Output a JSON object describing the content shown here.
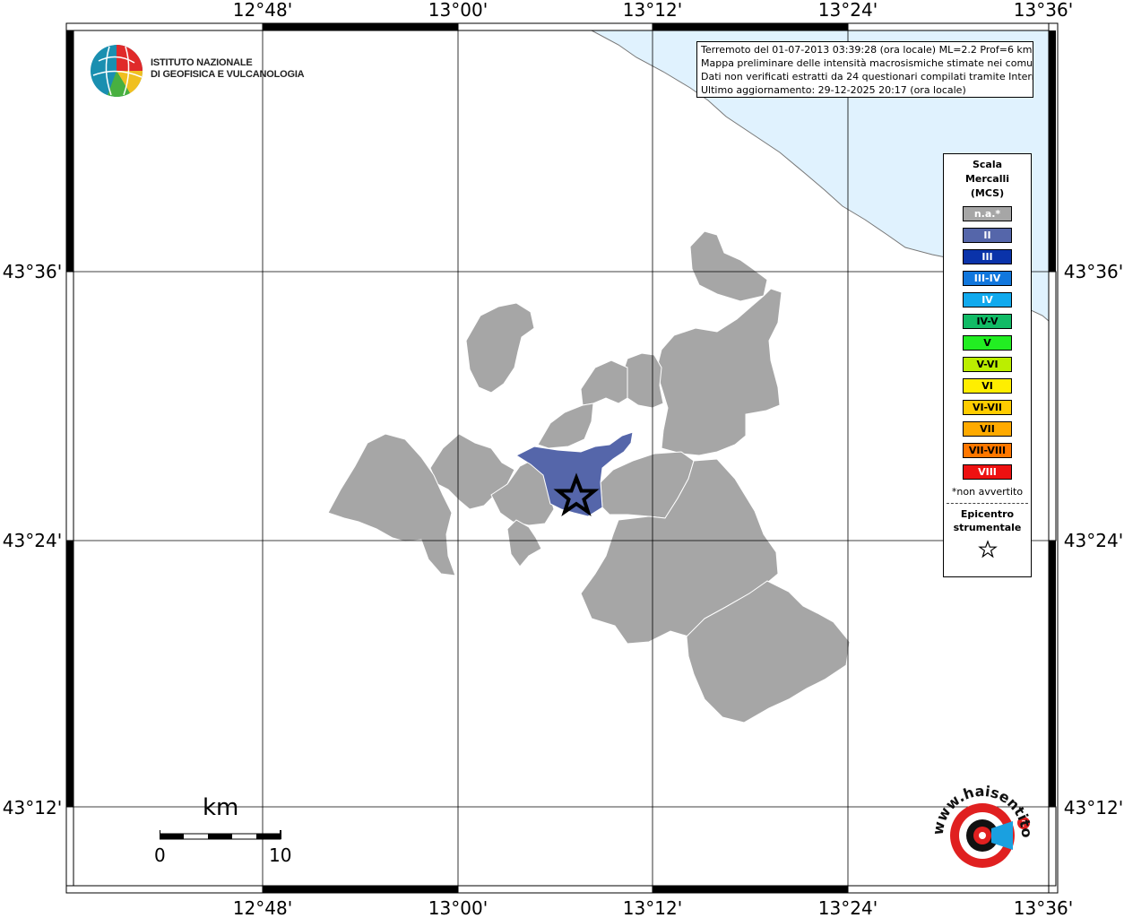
{
  "axes": {
    "longitude_labels": [
      "12°48'",
      "13°00'",
      "13°12'",
      "13°24'",
      "13°36'"
    ],
    "latitude_labels": [
      "43°36'",
      "43°24'",
      "43°12'"
    ]
  },
  "institute": {
    "line1": "ISTITUTO NAZIONALE",
    "line2": "DI GEOFISICA E VULCANOLOGIA"
  },
  "info": {
    "line1": "Terremoto del 01-07-2013 03:39:28 (ora locale) ML=2.2 Prof=6 km",
    "line2": "Mappa preliminare delle intensità macrosismiche stimate nei comuni",
    "line3": "Dati non verificati estratti da 24 questionari compilati tramite Internet.",
    "line4": "Ultimo aggiornamento: 29-12-2025 20:17 (ora locale)"
  },
  "legend": {
    "title_line1": "Scala",
    "title_line2": "Mercalli",
    "title_line3": "(MCS)",
    "items": [
      {
        "label": "n.a.*",
        "color": "#a6a6a6",
        "text_color": "#ffffff"
      },
      {
        "label": "II",
        "color": "#5566aa",
        "text_color": "#ffffff"
      },
      {
        "label": "III",
        "color": "#0a33aa",
        "text_color": "#ffffff"
      },
      {
        "label": "III-IV",
        "color": "#1177dd",
        "text_color": "#ffffff"
      },
      {
        "label": "IV",
        "color": "#11aaee",
        "text_color": "#ffffff"
      },
      {
        "label": "IV-V",
        "color": "#11bb66",
        "text_color": "#000000"
      },
      {
        "label": "V",
        "color": "#22ee22",
        "text_color": "#000000"
      },
      {
        "label": "V-VI",
        "color": "#bbee00",
        "text_color": "#000000"
      },
      {
        "label": "VI",
        "color": "#ffee00",
        "text_color": "#000000"
      },
      {
        "label": "VI-VII",
        "color": "#ffcc00",
        "text_color": "#000000"
      },
      {
        "label": "VII",
        "color": "#ffaa00",
        "text_color": "#000000"
      },
      {
        "label": "VII-VIII",
        "color": "#ff7700",
        "text_color": "#000000"
      },
      {
        "label": "VIII",
        "color": "#ee1111",
        "text_color": "#ffffff"
      }
    ],
    "note": "*non avvertito",
    "epicenter_line1": "Epicentro",
    "epicenter_line2": "strumentale",
    "epicenter_icon": "star-outline-icon"
  },
  "scale_bar": {
    "unit": "km",
    "min_label": "0",
    "max_label": "10"
  },
  "badge": {
    "text": "www.haisentitoilterremoto.it",
    "icon": "seismometer-badge-icon"
  },
  "colors": {
    "sea": "#e0f2fe",
    "municipality_na": "#a6a6a6",
    "municipality_II": "#5566aa",
    "grid": "#000000"
  }
}
